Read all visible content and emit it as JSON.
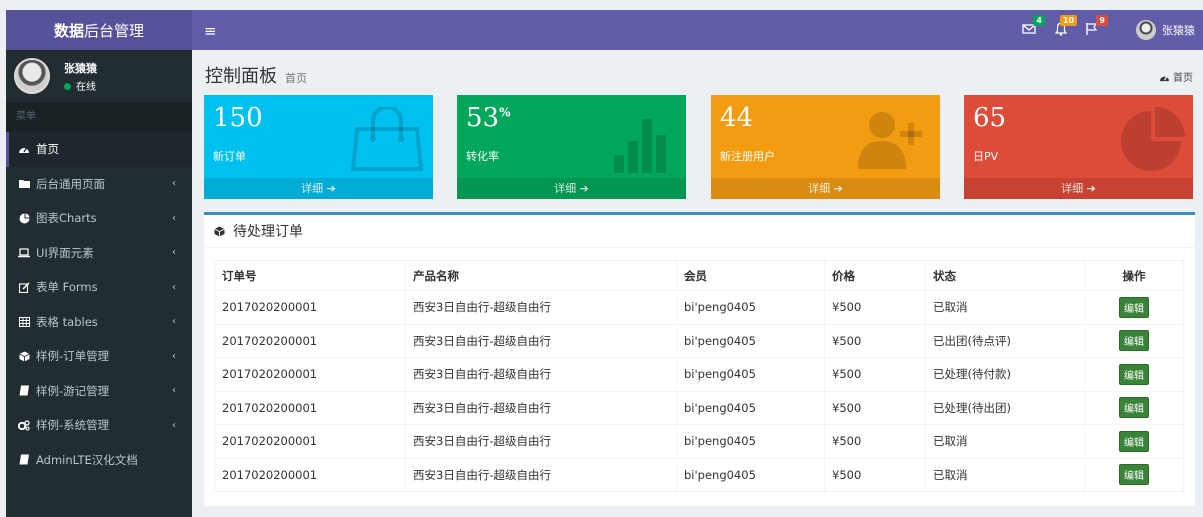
{
  "app": {
    "logo_bold": "数据",
    "logo_rest": "后台管理"
  },
  "user": {
    "name": "张猿猿",
    "status": "在线"
  },
  "sidebar": {
    "header": "菜单",
    "items": [
      {
        "label": "首页",
        "icon": "dashboard-icon",
        "active": true
      },
      {
        "label": "后台通用页面",
        "icon": "folder-icon",
        "caret": "‹"
      },
      {
        "label": "图表Charts",
        "icon": "pie-chart-icon",
        "caret": "‹"
      },
      {
        "label": "UI界面元素",
        "icon": "laptop-icon",
        "caret": "‹"
      },
      {
        "label": "表单 Forms",
        "icon": "edit-icon",
        "caret": "‹"
      },
      {
        "label": "表格 tables",
        "icon": "table-icon",
        "caret": "‹"
      },
      {
        "label": "样例-订单管理",
        "icon": "cube-icon",
        "caret": "‹"
      },
      {
        "label": "样例-游记管理",
        "icon": "book-icon",
        "caret": "‹"
      },
      {
        "label": "样例-系统管理",
        "icon": "cogs-icon",
        "caret": "‹"
      },
      {
        "label": "AdminLTE汉化文档",
        "icon": "book-icon"
      }
    ]
  },
  "topbar": {
    "messages_badge": "4",
    "notifications_badge": "10",
    "tasks_badge": "9",
    "user_name": "张猿猿"
  },
  "page": {
    "title": "控制面板",
    "subtitle": "首页",
    "breadcrumb": "首页"
  },
  "stats": [
    {
      "value": "150",
      "suffix": "",
      "label": "新订单",
      "footer": "详细",
      "color": "#00c0ef",
      "icon": "shopping-bag-icon"
    },
    {
      "value": "53",
      "suffix": "%",
      "label": "转化率",
      "footer": "详细",
      "color": "#00a65a",
      "icon": "bar-chart-icon"
    },
    {
      "value": "44",
      "suffix": "",
      "label": "新注册用户",
      "footer": "详细",
      "color": "#f39c12",
      "icon": "user-plus-icon"
    },
    {
      "value": "65",
      "suffix": "",
      "label": "日PV",
      "footer": "详细",
      "color": "#dd4b39",
      "icon": "pie-chart-icon"
    }
  ],
  "orders": {
    "title": "待处理订单",
    "columns": [
      "订单号",
      "产品名称",
      "会员",
      "价格",
      "状态",
      "操作"
    ],
    "rows": [
      {
        "id": "2017020200001",
        "product": "西安3日自由行-超级自由行",
        "member": "bi'peng0405",
        "price": "¥500",
        "status": "已取消",
        "action": "编辑"
      },
      {
        "id": "2017020200001",
        "product": "西安3日自由行-超级自由行",
        "member": "bi'peng0405",
        "price": "¥500",
        "status": "已出团(待点评)",
        "action": "编辑"
      },
      {
        "id": "2017020200001",
        "product": "西安3日自由行-超级自由行",
        "member": "bi'peng0405",
        "price": "¥500",
        "status": "已处理(待付款)",
        "action": "编辑"
      },
      {
        "id": "2017020200001",
        "product": "西安3日自由行-超级自由行",
        "member": "bi'peng0405",
        "price": "¥500",
        "status": "已处理(待出团)",
        "action": "编辑"
      },
      {
        "id": "2017020200001",
        "product": "西安3日自由行-超级自由行",
        "member": "bi'peng0405",
        "price": "¥500",
        "status": "已取消",
        "action": "编辑"
      },
      {
        "id": "2017020200001",
        "product": "西安3日自由行-超级自由行",
        "member": "bi'peng0405",
        "price": "¥500",
        "status": "已取消",
        "action": "编辑"
      }
    ]
  }
}
